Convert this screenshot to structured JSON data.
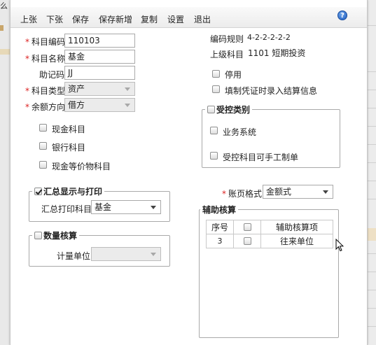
{
  "background": {
    "left_cut_text": "么"
  },
  "toolbar": {
    "prev_label": "上张",
    "next_label": "下张",
    "save_label": "保存",
    "save_new_label": "保存新增",
    "copy_label": "复制",
    "settings_label": "设置",
    "exit_label": "退出",
    "help_icon": "?"
  },
  "form": {
    "required_mark": "*",
    "code": {
      "label": "科目编码",
      "value": "110103"
    },
    "name": {
      "label": "科目名称",
      "value": "基金"
    },
    "mnemonic": {
      "label": "助记码",
      "value": "JJ"
    },
    "type": {
      "label": "科目类型",
      "value": "资产"
    },
    "balance_dir": {
      "label": "余额方向",
      "value": "借方"
    },
    "cash_account": "现金科目",
    "bank_account": "银行科目",
    "cash_equiv": "现金等价物科目",
    "summary_group": {
      "title": "汇总显示与打印",
      "checked": true,
      "print_label": "汇总打印科目",
      "print_value": "基金"
    },
    "quantity_group": {
      "title": "数量核算",
      "checked": false,
      "unit_label": "计量单位",
      "unit_value": ""
    }
  },
  "right": {
    "code_rule_label": "编码规则",
    "code_rule_value": "4-2-2-2-2-2",
    "parent_label": "上级科目",
    "parent_value": "1101 短期投资",
    "disabled_label": "停用",
    "settlement_label": "填制凭证时录入结算信息",
    "controlled_group": {
      "title": "受控类别",
      "business_label": "业务系统",
      "manual_label": "受控科目可手工制单"
    },
    "ledger_format_label": "账页格式",
    "ledger_format_value": "金额式",
    "aux_group": {
      "title": "辅助核算",
      "headers": [
        "序号",
        "",
        "辅助核算项"
      ],
      "rows": [
        {
          "no": "3",
          "item": "往来单位"
        }
      ]
    }
  }
}
